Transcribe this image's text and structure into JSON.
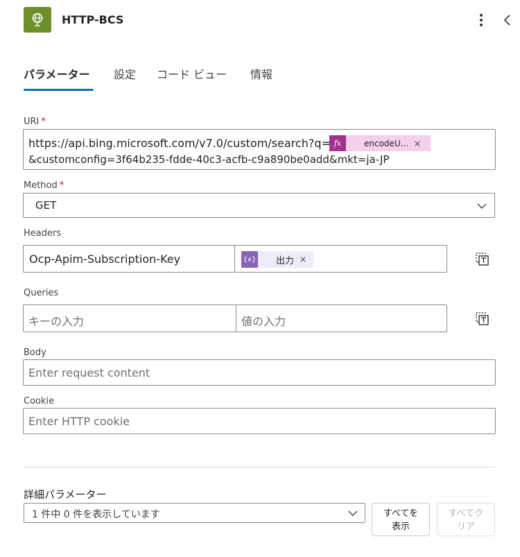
{
  "header": {
    "title": "HTTP-BCS",
    "icon": "globe-icon",
    "icon_color": "#6e8f2c"
  },
  "tabs": [
    {
      "label": "パラメーター",
      "active": true
    },
    {
      "label": "設定",
      "active": false
    },
    {
      "label": "コード ビュー",
      "active": false
    },
    {
      "label": "情報",
      "active": false
    }
  ],
  "fields": {
    "uri": {
      "label": "URI",
      "required_mark": "*",
      "line1": "https://api.bing.microsoft.com/v7.0/custom/search?q=",
      "token": {
        "badge": "fx",
        "text": "encodeU...",
        "remove": "×"
      },
      "line2": "&customconfig=3f64b235-fdde-40c3-acfb-c9a890be0add&mkt=ja-JP"
    },
    "method": {
      "label": "Method",
      "required_mark": "*",
      "value": "GET"
    },
    "headers": {
      "label": "Headers",
      "key": "Ocp-Apim-Subscription-Key",
      "token": {
        "badge": "{x}",
        "text": "出力",
        "remove": "×"
      }
    },
    "queries": {
      "label": "Queries",
      "key_placeholder": "キーの入力",
      "value_placeholder": "値の入力"
    },
    "body": {
      "label": "Body",
      "placeholder": "Enter request content"
    },
    "cookie": {
      "label": "Cookie",
      "placeholder": "Enter HTTP cookie"
    }
  },
  "advanced": {
    "label": "詳細パラメーター",
    "select_text": "1 件中 0 件を表示しています",
    "show_all_line1": "すべてを",
    "show_all_line2": "表示",
    "clear_all_line1": "すべてク",
    "clear_all_line2": "リア"
  },
  "colors": {
    "accent": "#0f6cbd",
    "fx_token": "#a4318f",
    "var_token": "#8764b8",
    "required": "#c50f1f"
  }
}
